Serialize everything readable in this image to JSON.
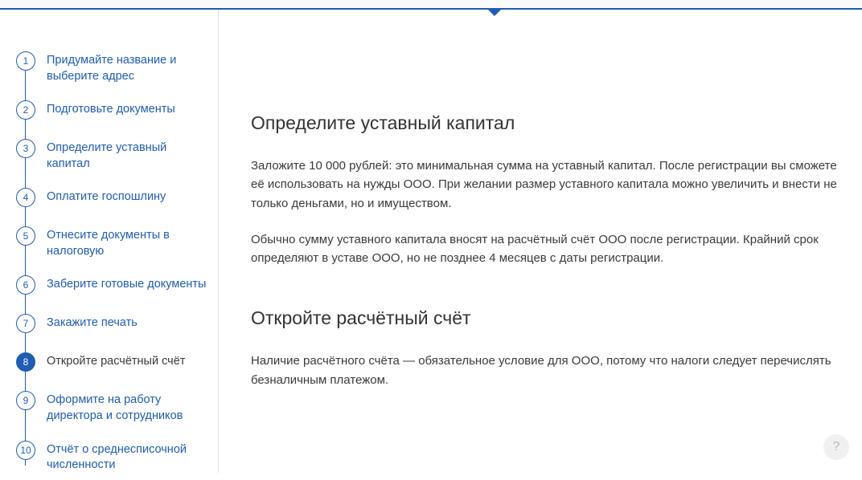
{
  "sidebar": {
    "steps": [
      {
        "num": "1",
        "label": "Придумайте название и выберите адрес"
      },
      {
        "num": "2",
        "label": "Подготовьте документы"
      },
      {
        "num": "3",
        "label": "Определите уставный капитал"
      },
      {
        "num": "4",
        "label": "Оплатите госпошлину"
      },
      {
        "num": "5",
        "label": "Отнесите документы в налоговую"
      },
      {
        "num": "6",
        "label": "Заберите готовые документы"
      },
      {
        "num": "7",
        "label": "Закажите печать"
      },
      {
        "num": "8",
        "label": "Откройте расчётный счёт"
      },
      {
        "num": "9",
        "label": "Оформите на работу директора и сотрудников"
      },
      {
        "num": "10",
        "label": "Отчёт о среднесписочной численности"
      }
    ],
    "active_index": 7
  },
  "content": {
    "section1": {
      "heading": "Определите уставный капитал",
      "para1": "Заложите 10 000 рублей: это минимальная сумма на уставный капитал. После регистрации вы сможете её использовать на нужды ООО. При желании размер уставного капитала можно увеличить и внести не только деньгами, но и имуществом.",
      "para2": "Обычно сумму уставного капитала вносят на расчётный счёт ООО после регистрации. Крайний срок определяют в уставе ООО, но не позднее 4 месяцев с даты регистрации."
    },
    "section2": {
      "heading": "Откройте расчётный счёт",
      "para1": "Наличие расчётного счёта — обязательное условие для ООО, потому что налоги следует перечислять безналичным платежом."
    }
  },
  "help": {
    "glyph": "?"
  }
}
